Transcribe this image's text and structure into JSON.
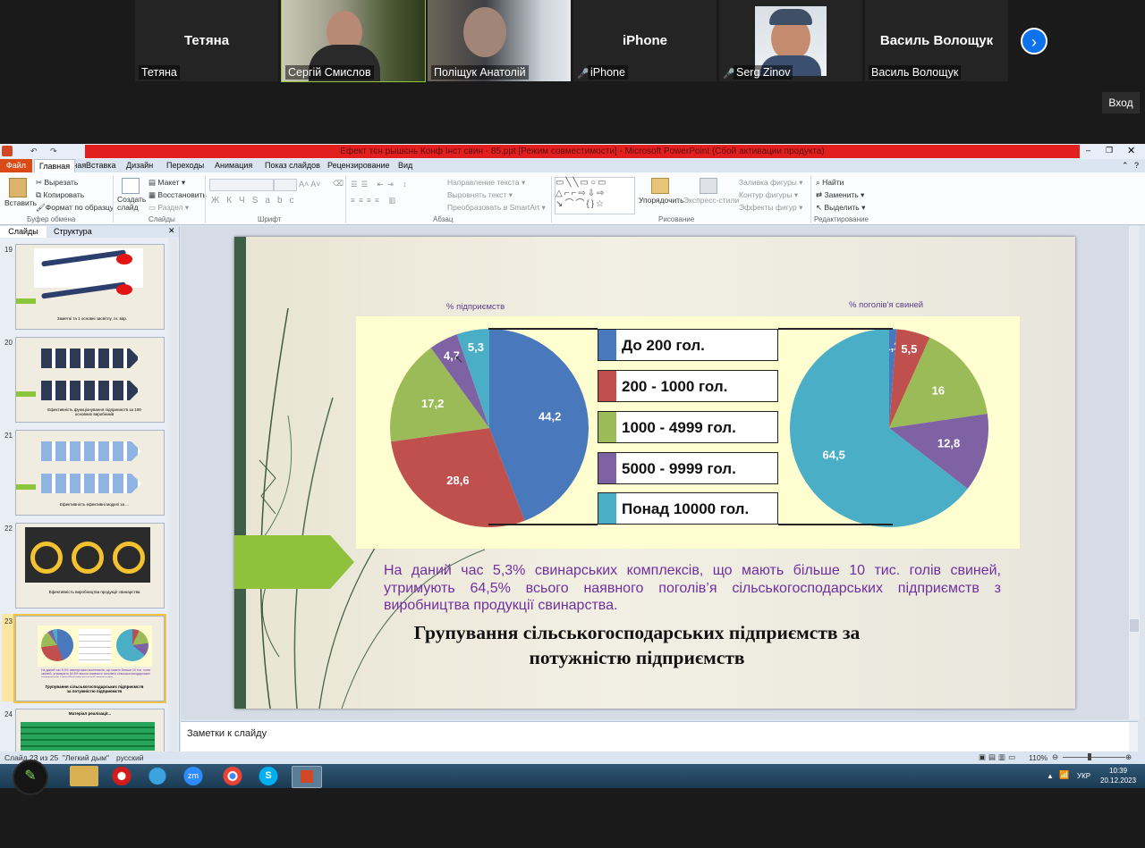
{
  "zoom": {
    "participants": [
      {
        "big_name": "Тетяна",
        "label": "Тетяна",
        "muted": false
      },
      {
        "big_name": "",
        "label": "Сергій Смислов",
        "muted": false
      },
      {
        "big_name": "",
        "label": "Поліщук Анатолій",
        "muted": false
      },
      {
        "big_name": "iPhone",
        "label": "iPhone",
        "muted": true
      },
      {
        "big_name": "",
        "label": "Serg Zinov",
        "muted": true
      },
      {
        "big_name": "Василь Волощук",
        "label": "Василь Волощук",
        "muted": false
      }
    ],
    "next_icon": "chevron-right-icon",
    "exit_label": "Вход"
  },
  "ppt": {
    "window_title": "Ефект тєн рышєнь Конф Інст свин - 85.ppt [Режим совместимости] - Microsoft PowerPoint (Сбой активации продукта)",
    "menu": {
      "file": "Файл",
      "tabs": [
        "Главная",
        "Вставка",
        "Дизайн",
        "Переходы",
        "Анимация",
        "Показ слайдов",
        "Рецензирование",
        "Вид"
      ]
    },
    "ribbon": {
      "paste": "Вставить",
      "cut": "Вырезать",
      "copy": "Копировать",
      "format_painter": "Формат по образцу",
      "clipboard_group": "Буфер обмена",
      "new_slide": "Создать слайд",
      "layout": "Макет",
      "reset": "Восстановить",
      "section": "Раздел",
      "slides_group": "Слайды",
      "font_group": "Шрифт",
      "paragraph_group": "Абзац",
      "text_direction": "Направление текста",
      "align_text": "Выровнять текст",
      "smartart": "Преобразовать в SmartArt",
      "arrange": "Упорядочить",
      "quick_styles": "Экспресс-стили",
      "shape_fill": "Заливка фигуры",
      "shape_outline": "Контур фигуры",
      "shape_effects": "Эффекты фигур",
      "drawing_group": "Рисование",
      "find": "Найти",
      "replace": "Заменить",
      "select": "Выделить",
      "editing_group": "Редактирование"
    },
    "panel_tabs": [
      "Слайды",
      "Структура"
    ],
    "thumbnails": [
      {
        "num": "19",
        "caption": "Заметні та 1 основні засвітлу, гн. вар."
      },
      {
        "num": "20",
        "caption": "Ефективність функціонування підприємств за 100 основних виробників"
      },
      {
        "num": "21",
        "caption": "Ефективність ефективні моделі за ..."
      },
      {
        "num": "22",
        "caption": "Ефективність виробництва продукції свинарства"
      },
      {
        "num": "23",
        "caption": "Групування сільськогосподарських підприємств за потужністю підприємств"
      },
      {
        "num": "24",
        "caption": "Матеріал реалізації..."
      }
    ],
    "notes_placeholder": "Заметки к слайду",
    "status": {
      "slide": "Слайд 23 из 25",
      "theme": "\"Легкий дым\"",
      "language": "русский",
      "zoom": "110%"
    },
    "clock": {
      "time": "10:39",
      "date": "20.12.2023",
      "lang": "УКР"
    }
  },
  "slide": {
    "left_chart_title": "% підприємств",
    "right_chart_title": "% поголів'я  свиней",
    "body_text": "На даний час 5,3% свинарських комплексів, що мають більше 10 тис. голів свиней, утримують 64,5% всього наявного поголів’я  сільськогосподарських підприємств з виробництва продукції свинарства.",
    "title_line1": "Групування сільськогосподарських підприємств за",
    "title_line2": "потужністю підприємств"
  },
  "chart_data": [
    {
      "type": "pie",
      "title": "% підприємств",
      "categories": [
        "До 200 гол.",
        "200 - 1000 гол.",
        "1000 - 4999 гол.",
        "5000 - 9999 гол.",
        "Понад 10000 гол."
      ],
      "values": [
        44.2,
        28.6,
        17.2,
        4.7,
        5.3
      ],
      "labels": [
        "44,2",
        "28,6",
        "17,2",
        "4,7",
        "5,3"
      ],
      "colors": [
        "#4a78bd",
        "#c0504d",
        "#9bbb59",
        "#7f62a3",
        "#4aaec7"
      ]
    },
    {
      "type": "pie",
      "title": "% поголів'я  свиней",
      "categories": [
        "До 200 гол.",
        "200 - 1000 гол.",
        "1000 - 4999 гол.",
        "5000 - 9999 гол.",
        "Понад 10000 гол."
      ],
      "values": [
        1.2,
        5.5,
        16,
        12.8,
        64.5
      ],
      "labels": [
        "1,2",
        "5,5",
        "16",
        "12,8",
        "64,5"
      ],
      "colors": [
        "#4a78bd",
        "#c0504d",
        "#9bbb59",
        "#7f62a3",
        "#4aaec7"
      ]
    }
  ],
  "legend": [
    {
      "label": "До 200 гол.",
      "color": "#4a78bd"
    },
    {
      "label": "200 - 1000 гол.",
      "color": "#c0504d"
    },
    {
      "label": "1000 - 4999 гол.",
      "color": "#9bbb59"
    },
    {
      "label": "5000 - 9999 гол.",
      "color": "#7f62a3"
    },
    {
      "label": "Понад 10000 гол.",
      "color": "#4aaec7"
    }
  ]
}
